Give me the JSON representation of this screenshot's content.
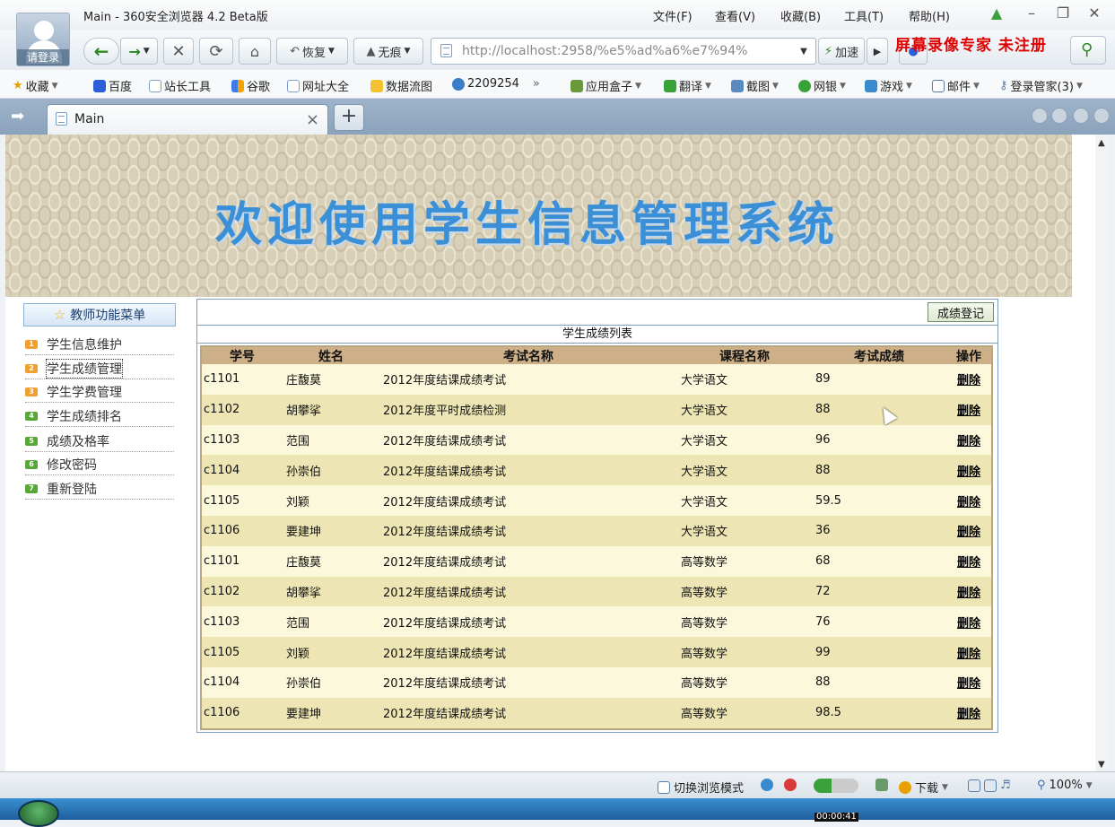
{
  "window": {
    "title": "Main - 360安全浏览器 4.2 Beta版",
    "avatar_label": "请登录",
    "menus": [
      "文件(F)",
      "查看(V)",
      "收藏(B)",
      "工具(T)",
      "帮助(H)"
    ]
  },
  "toolbar": {
    "restore_label": "恢复",
    "notrace_label": "无痕",
    "url": "http://localhost:2958/%e5%ad%a6%e7%94%",
    "speed_label": "加速",
    "watermark": "屏幕录像专家  未注册"
  },
  "favorites": [
    "收藏",
    "百度",
    "站长工具",
    "谷歌",
    "网址大全",
    "数据流图",
    "2209254",
    "应用盒子",
    "翻译",
    "截图",
    "网银",
    "游戏",
    "邮件",
    "登录管家(3)"
  ],
  "tab": {
    "label": "Main"
  },
  "banner": {
    "title": "欢迎使用学生信息管理系统"
  },
  "sidebar": {
    "header": "教师功能菜单",
    "items": [
      {
        "num": "1",
        "label": "学生信息维护",
        "color": "#f0a030"
      },
      {
        "num": "2",
        "label": "学生成绩管理",
        "color": "#f0a030"
      },
      {
        "num": "3",
        "label": "学生学费管理",
        "color": "#f0a030"
      },
      {
        "num": "4",
        "label": "学生成绩排名",
        "color": "#58a838"
      },
      {
        "num": "5",
        "label": "成绩及格率",
        "color": "#58a838"
      },
      {
        "num": "6",
        "label": "修改密码",
        "color": "#58a838"
      },
      {
        "num": "7",
        "label": "重新登陆",
        "color": "#58a838"
      }
    ]
  },
  "grades": {
    "register_button": "成绩登记",
    "caption": "学生成绩列表",
    "columns": [
      "学号",
      "姓名",
      "考试名称",
      "课程名称",
      "考试成绩",
      "操作"
    ],
    "rows": [
      [
        "c1101",
        "庄馥莫",
        "2012年度结课成绩考试",
        "大学语文",
        "89",
        "删除"
      ],
      [
        "c1102",
        "胡攀挲",
        "2012年度平时成绩检测",
        "大学语文",
        "88",
        "删除"
      ],
      [
        "c1103",
        "范围",
        "2012年度结课成绩考试",
        "大学语文",
        "96",
        "删除"
      ],
      [
        "c1104",
        "孙崇伯",
        "2012年度结课成绩考试",
        "大学语文",
        "88",
        "删除"
      ],
      [
        "c1105",
        "刘颖",
        "2012年度结课成绩考试",
        "大学语文",
        "59.5",
        "删除"
      ],
      [
        "c1106",
        "要建坤",
        "2012年度结课成绩考试",
        "大学语文",
        "36",
        "删除"
      ],
      [
        "c1101",
        "庄馥莫",
        "2012年度结课成绩考试",
        "高等数学",
        "68",
        "删除"
      ],
      [
        "c1102",
        "胡攀挲",
        "2012年度结课成绩考试",
        "高等数学",
        "72",
        "删除"
      ],
      [
        "c1103",
        "范围",
        "2012年度结课成绩考试",
        "高等数学",
        "76",
        "删除"
      ],
      [
        "c1105",
        "刘颖",
        "2012年度结课成绩考试",
        "高等数学",
        "99",
        "删除"
      ],
      [
        "c1104",
        "孙崇伯",
        "2012年度结课成绩考试",
        "高等数学",
        "88",
        "删除"
      ],
      [
        "c1106",
        "要建坤",
        "2012年度结课成绩考试",
        "高等数学",
        "98.5",
        "删除"
      ]
    ]
  },
  "status": {
    "switch_mode": "切换浏览模式",
    "download": "下载",
    "zoom": "100%",
    "recording_time": "00:00:41"
  }
}
